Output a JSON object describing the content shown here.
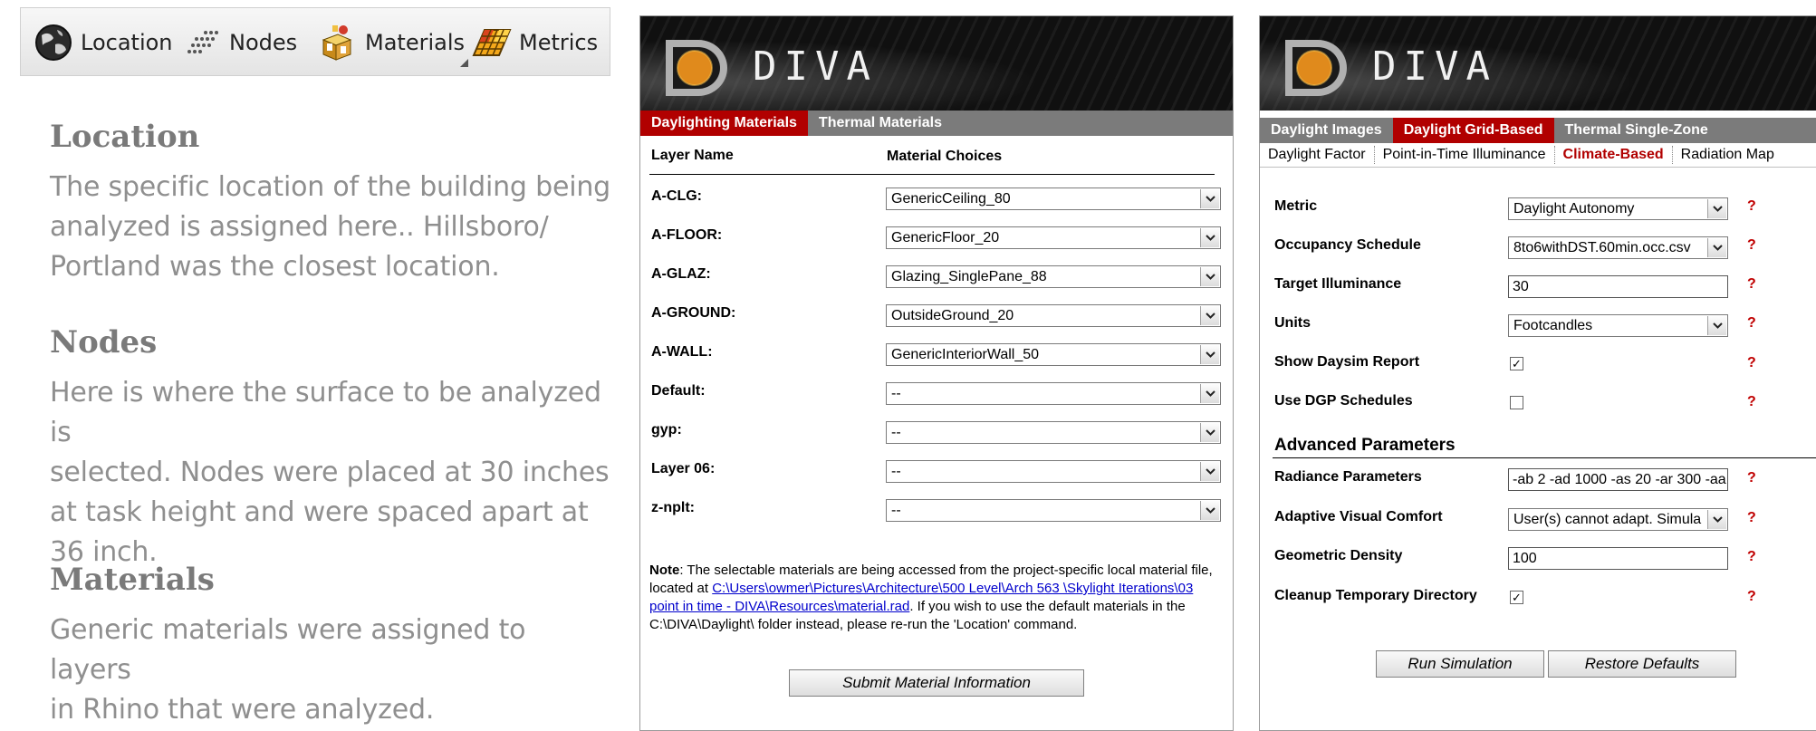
{
  "toolbar": {
    "items": [
      {
        "label": "Location",
        "icon": "globe-icon"
      },
      {
        "label": "Nodes",
        "icon": "nodes-grid-icon"
      },
      {
        "label": "Materials",
        "icon": "materials-box-icon"
      },
      {
        "label": "Metrics",
        "icon": "metrics-grid-icon"
      }
    ]
  },
  "description": {
    "sections": [
      {
        "heading": "Location",
        "lines": [
          "The specific location of the building being",
          "analyzed is assigned here.. Hillsboro/",
          "Portland was the closest location."
        ]
      },
      {
        "heading": "Nodes",
        "lines": [
          "Here is where the surface to be analyzed is",
          "selected. Nodes were placed at 30 inches",
          "at task height and were spaced apart at",
          "36 inch."
        ]
      },
      {
        "heading": "Materials",
        "lines": [
          "Generic materials were assigned to layers",
          "in Rhino that were analyzed."
        ]
      }
    ]
  },
  "materials_window": {
    "title": "DIVA",
    "tabs": [
      {
        "label": "Daylighting Materials",
        "active": true
      },
      {
        "label": "Thermal Materials",
        "active": false
      }
    ],
    "col_layer": "Layer Name",
    "col_material": "Material Choices",
    "rows": [
      {
        "layer": "A-CLG:",
        "material": "GenericCeiling_80"
      },
      {
        "layer": "A-FLOOR:",
        "material": "GenericFloor_20"
      },
      {
        "layer": "A-GLAZ:",
        "material": "Glazing_SinglePane_88"
      },
      {
        "layer": "A-GROUND:",
        "material": "OutsideGround_20"
      },
      {
        "layer": "A-WALL:",
        "material": "GenericInteriorWall_50"
      },
      {
        "layer": "Default:",
        "material": "--"
      },
      {
        "layer": "gyp:",
        "material": "--"
      },
      {
        "layer": "Layer 06:",
        "material": "--"
      },
      {
        "layer": "z-nplt:",
        "material": "--"
      }
    ],
    "note_label": "Note",
    "note_text1": ": The selectable materials are being accessed from the project-specific local material file, located at ",
    "note_link": "C:\\Users\\owmer\\Pictures\\Architecture\\500 Level\\Arch 563 \\Skylight Iterations\\03 point in time - DIVA\\Resources\\material.rad",
    "note_text2": ". If you wish to use the default materials in the C:\\DIVA\\Daylight\\ folder instead, please re-run the 'Location' command.",
    "submit_label": "Submit Material Information"
  },
  "metrics_window": {
    "title": "DIVA",
    "tabs": [
      {
        "label": "Daylight Images",
        "active": false
      },
      {
        "label": "Daylight Grid-Based",
        "active": true
      },
      {
        "label": "Thermal Single-Zone",
        "active": false
      }
    ],
    "subtabs": [
      {
        "label": "Daylight Factor",
        "active": false
      },
      {
        "label": "Point-in-Time Illuminance",
        "active": false
      },
      {
        "label": "Climate-Based",
        "active": true
      },
      {
        "label": "Radiation Map",
        "active": false
      }
    ],
    "fields": {
      "metric": {
        "label": "Metric",
        "value": "Daylight Autonomy"
      },
      "occupancy": {
        "label": "Occupancy Schedule",
        "value": "8to6withDST.60min.occ.csv"
      },
      "target": {
        "label": "Target Illuminance",
        "value": "30"
      },
      "units": {
        "label": "Units",
        "value": "Footcandles"
      },
      "daysim": {
        "label": "Show Daysim Report",
        "checked": true
      },
      "dgp": {
        "label": "Use DGP Schedules",
        "checked": false
      }
    },
    "advanced_heading": "Advanced Parameters",
    "advanced": {
      "radiance": {
        "label": "Radiance Parameters",
        "value": "-ab 2 -ad 1000 -as 20 -ar 300 -aa"
      },
      "comfort": {
        "label": "Adaptive Visual Comfort",
        "value": "User(s) cannot adapt. Simula"
      },
      "density": {
        "label": "Geometric Density",
        "value": "100"
      },
      "cleanup": {
        "label": "Cleanup Temporary Directory",
        "checked": true
      }
    },
    "help_mark": "?",
    "run_label": "Run Simulation",
    "restore_label": "Restore Defaults"
  },
  "colors": {
    "accent_red": "#b10000",
    "tab_gray": "#7b7b7b",
    "header_black": "#101010",
    "link_blue": "#0000cc"
  }
}
